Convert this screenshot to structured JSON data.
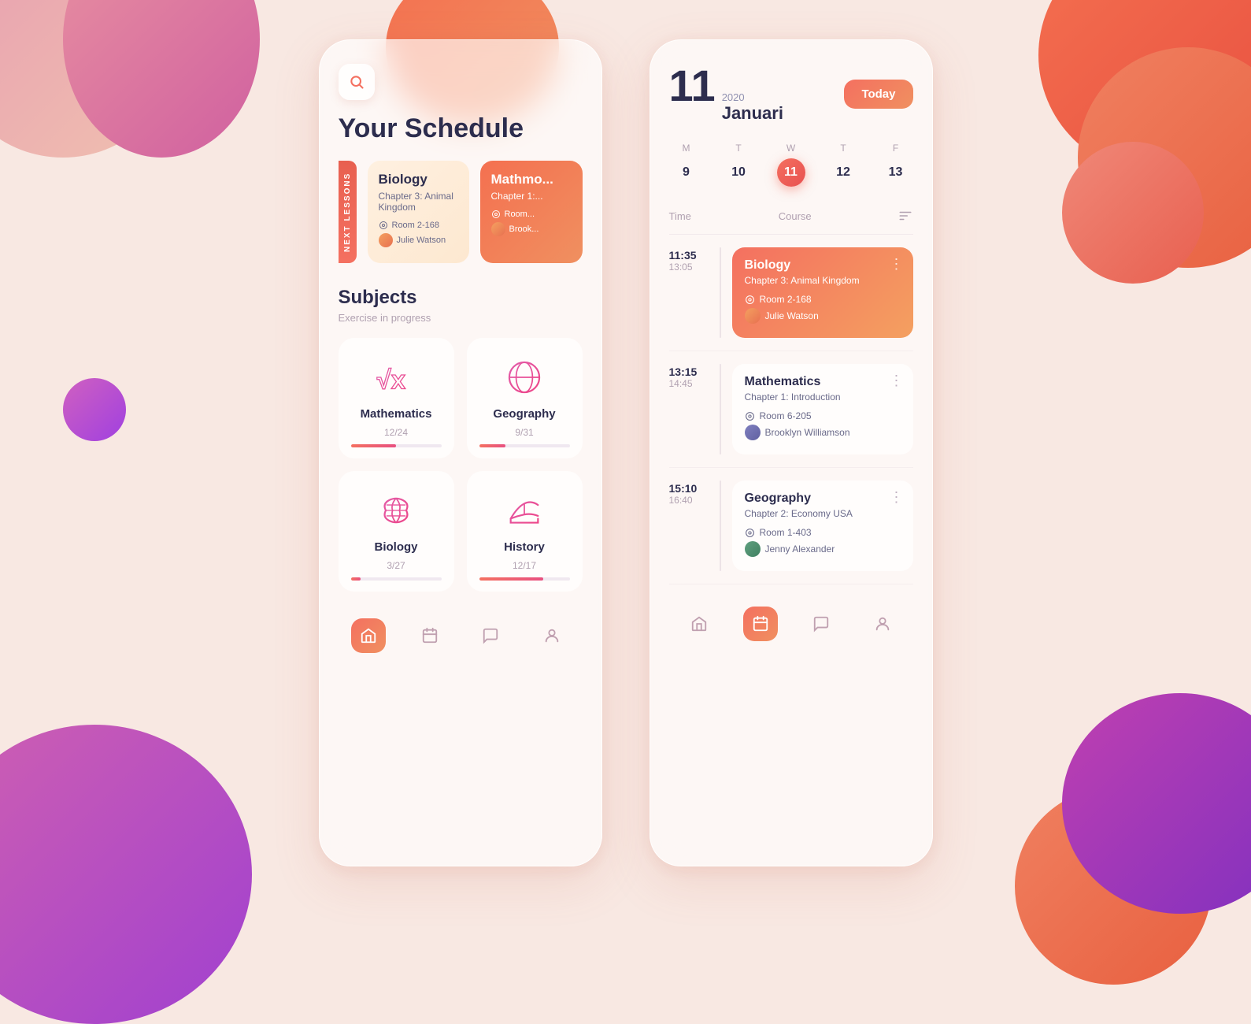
{
  "background": {
    "color": "#f8e8e2"
  },
  "left_phone": {
    "search_label": "Search",
    "title": "Your Schedule",
    "next_lessons_label": "NEXT LESSONS",
    "lessons": [
      {
        "title": "Biology",
        "chapter": "Chapter 3: Animal Kingdom",
        "room": "Room 2-168",
        "teacher": "Julie Watson",
        "style": "light"
      },
      {
        "title": "Mathmo...",
        "chapter": "Chapter 1: ...",
        "room": "Room...",
        "teacher": "Brook...",
        "style": "orange"
      }
    ],
    "subjects_title": "Subjects",
    "subjects_subtitle": "Exercise in progress",
    "subjects": [
      {
        "name": "Mathematics",
        "progress_text": "12/24",
        "progress_pct": 50
      },
      {
        "name": "Geography",
        "progress_text": "9/31",
        "progress_pct": 29
      },
      {
        "name": "Biology",
        "progress_text": "3/27",
        "progress_pct": 11
      },
      {
        "name": "History",
        "progress_text": "12/17",
        "progress_pct": 71
      }
    ],
    "nav": [
      {
        "name": "home",
        "active": true
      },
      {
        "name": "calendar",
        "active": false
      },
      {
        "name": "chat",
        "active": false
      },
      {
        "name": "profile",
        "active": false
      }
    ]
  },
  "right_phone": {
    "date_day": "11",
    "date_year": "2020",
    "date_month": "Januari",
    "today_label": "Today",
    "week_days": [
      {
        "letter": "M",
        "num": "9",
        "active": false
      },
      {
        "letter": "T",
        "num": "10",
        "active": false
      },
      {
        "letter": "W",
        "num": "11",
        "active": true
      },
      {
        "letter": "T",
        "num": "12",
        "active": false
      },
      {
        "letter": "F",
        "num": "13",
        "active": false
      }
    ],
    "schedule_header": {
      "time_label": "Time",
      "course_label": "Course"
    },
    "schedule_items": [
      {
        "time_start": "11:35",
        "time_end": "13:05",
        "title": "Biology",
        "chapter": "Chapter 3: Animal Kingdom",
        "room": "Room 2-168",
        "teacher": "Julie Watson",
        "style": "highlighted",
        "teacher_avatar": "orange"
      },
      {
        "time_start": "13:15",
        "time_end": "14:45",
        "title": "Mathematics",
        "chapter": "Chapter 1: Introduction",
        "room": "Room 6-205",
        "teacher": "Brooklyn Williamson",
        "style": "plain",
        "teacher_avatar": "purple"
      },
      {
        "time_start": "15:10",
        "time_end": "16:40",
        "title": "Geography",
        "chapter": "Chapter 2: Economy USA",
        "room": "Room 1-403",
        "teacher": "Jenny Alexander",
        "style": "plain",
        "teacher_avatar": "green"
      }
    ],
    "nav": [
      {
        "name": "home",
        "active": false
      },
      {
        "name": "calendar",
        "active": true
      },
      {
        "name": "chat",
        "active": false
      },
      {
        "name": "profile",
        "active": false
      }
    ]
  }
}
